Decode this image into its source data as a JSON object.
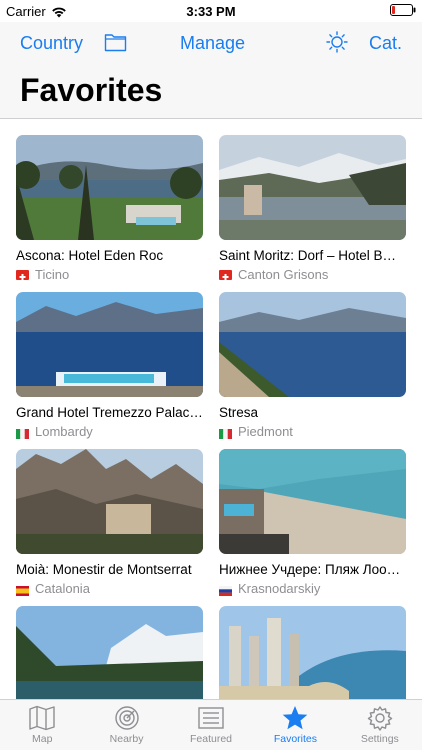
{
  "status": {
    "carrier": "Carrier",
    "time": "3:33 PM"
  },
  "nav": {
    "country_label": "Country",
    "manage_label": "Manage",
    "cat_label": "Cat."
  },
  "header": {
    "title": "Favorites"
  },
  "cards": [
    {
      "title": "Ascona: Hotel Eden Roc",
      "region": "Ticino",
      "flag": "swiss-flag"
    },
    {
      "title": "Saint Moritz: Dorf – Hotel B…",
      "region": "Canton Grisons",
      "flag": "swiss-flag"
    },
    {
      "title": "Grand Hotel Tremezzo Palac…",
      "region": "Lombardy",
      "flag": "italy-flag"
    },
    {
      "title": "Stresa",
      "region": "Piedmont",
      "flag": "italy-flag"
    },
    {
      "title": "Moià: Monestir de Montserrat",
      "region": "Catalonia",
      "flag": "spain-flag"
    },
    {
      "title": "Нижнее Учдере: Пляж Лоо…",
      "region": "Krasnodarskiy",
      "flag": "russia-flag"
    },
    {
      "title": "",
      "region": "",
      "flag": ""
    },
    {
      "title": "",
      "region": "",
      "flag": ""
    }
  ],
  "tabs": [
    {
      "label": "Map",
      "icon": "map-icon"
    },
    {
      "label": "Nearby",
      "icon": "radar-icon"
    },
    {
      "label": "Featured",
      "icon": "list-icon"
    },
    {
      "label": "Favorites",
      "icon": "star-icon"
    },
    {
      "label": "Settings",
      "icon": "gear-icon"
    }
  ],
  "colors": {
    "accent": "#1a7df0",
    "inactive": "#8e8e93",
    "bar": "#f7f7f7"
  }
}
